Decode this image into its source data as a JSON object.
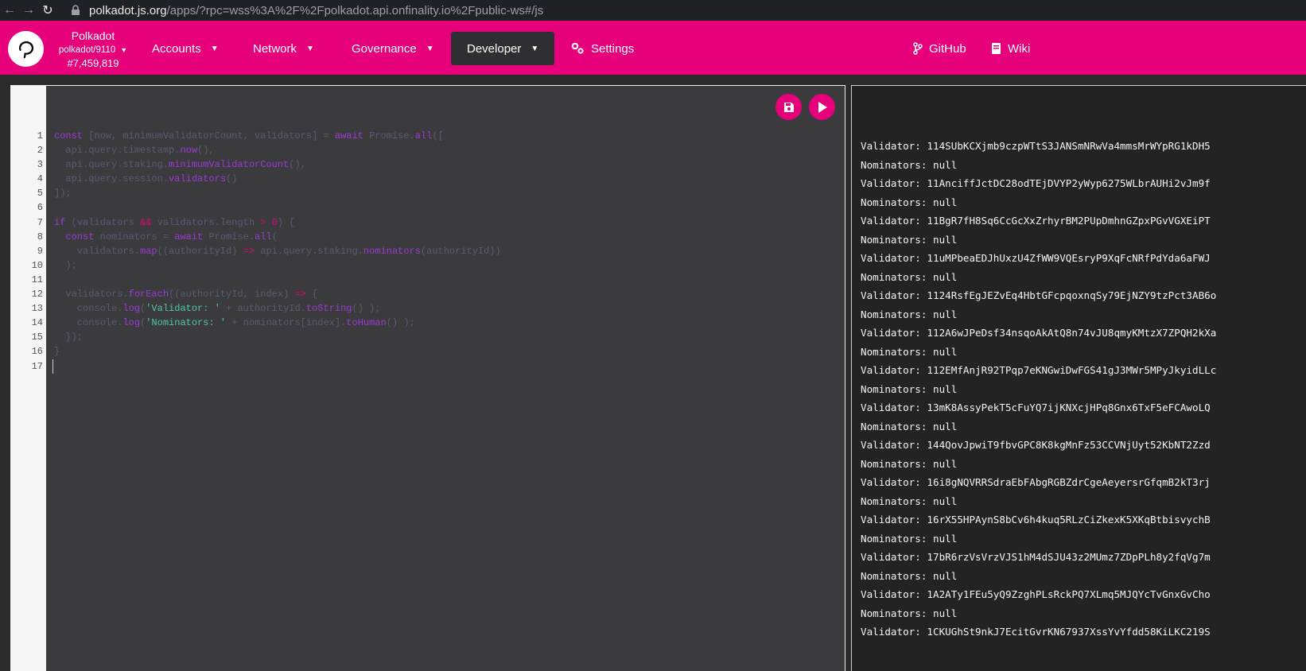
{
  "browser": {
    "url_host": "polkadot.js.org",
    "url_path": "/apps/?rpc=wss%3A%2F%2Fpolkadot.api.onfinality.io%2Fpublic-ws#/js"
  },
  "nav": {
    "chain_name": "Polkadot",
    "chain_version": "polkadot/9110",
    "block_number": "#7,459,819",
    "menu": [
      {
        "label": "Accounts"
      },
      {
        "label": "Network"
      },
      {
        "label": "Governance"
      },
      {
        "label": "Developer"
      },
      {
        "label": "Settings"
      }
    ],
    "github_label": "GitHub",
    "wiki_label": "Wiki"
  },
  "colors": {
    "brand": "#e6007a",
    "active_menu_bg": "#2f2f33"
  },
  "editor": {
    "line_numbers": [
      "1",
      "2",
      "3",
      "4",
      "5",
      "6",
      "7",
      "8",
      "9",
      "10",
      "11",
      "12",
      "13",
      "14",
      "15",
      "16",
      "17"
    ],
    "lines": [
      "const [now, minimumValidatorCount, validators] = await Promise.all([",
      "  api.query.timestamp.now(),",
      "  api.query.staking.minimumValidatorCount(),",
      "  api.query.session.validators()",
      "]);",
      "",
      "if (validators && validators.length > 0) {",
      "  const nominators = await Promise.all(",
      "    validators.map((authorityId) => api.query.staking.nominators(authorityId))",
      "  );",
      "",
      "  validators.forEach((authorityId, index) => {",
      "    console.log('Validator: ' + authorityId.toString() );",
      "    console.log('Nominators: ' + nominators[index].toHuman() );",
      "  });",
      "}",
      ""
    ],
    "save_icon": "save-icon",
    "run_icon": "play-icon"
  },
  "output": {
    "lines": [
      "Validator: 114SUbKCXjmb9czpWTtS3JANSmNRwVa4mmsMrWYpRG1kDH5",
      "Nominators: null",
      "Validator: 11AnciffJctDC28odTEjDVYP2yWyp6275WLbrAUHi2vJm9f",
      "Nominators: null",
      "Validator: 11BgR7fH8Sq6CcGcXxZrhyrBM2PUpDmhnGZpxPGvVGXEiPT",
      "Nominators: null",
      "Validator: 11uMPbeaEDJhUxzU4ZfWW9VQEsryP9XqFcNRfPdYda6aFWJ",
      "Nominators: null",
      "Validator: 1124RsfEgJEZvEq4HbtGFcpqoxnqSy79EjNZY9tzPct3AB6o",
      "Nominators: null",
      "Validator: 112A6wJPeDsf34nsqoAkAtQ8n74vJU8qmyKMtzX7ZPQH2kXa",
      "Nominators: null",
      "Validator: 112EMfAnjR92TPqp7eKNGwiDwFGS41gJ3MWr5MPyJkyidLLc",
      "Nominators: null",
      "Validator: 13mK8AssyPekT5cFuYQ7ijKNXcjHPq8Gnx6TxF5eFCAwoLQ",
      "Nominators: null",
      "Validator: 144QovJpwiT9fbvGPC8K8kgMnFz53CCVNjUyt52KbNT2Zzd",
      "Nominators: null",
      "Validator: 16i8gNQVRRSdraEbFAbgRGBZdrCgeAeyersrGfqmB2kT3rj",
      "Nominators: null",
      "Validator: 16rX55HPAynS8bCv6h4kuq5RLzCiZkexK5XKqBtbisvychB",
      "Nominators: null",
      "Validator: 17bR6rzVsVrzVJS1hM4dSJU43z2MUmz7ZDpPLh8y2fqVg7m",
      "Nominators: null",
      "Validator: 1A2ATy1FEu5yQ9ZzghPLsRckPQ7XLmq5MJQYcTvGnxGvCho",
      "Nominators: null",
      "Validator: 1CKUGhSt9nkJ7EcitGvrKN67937XssYvYfdd58KiLKC219S"
    ]
  }
}
